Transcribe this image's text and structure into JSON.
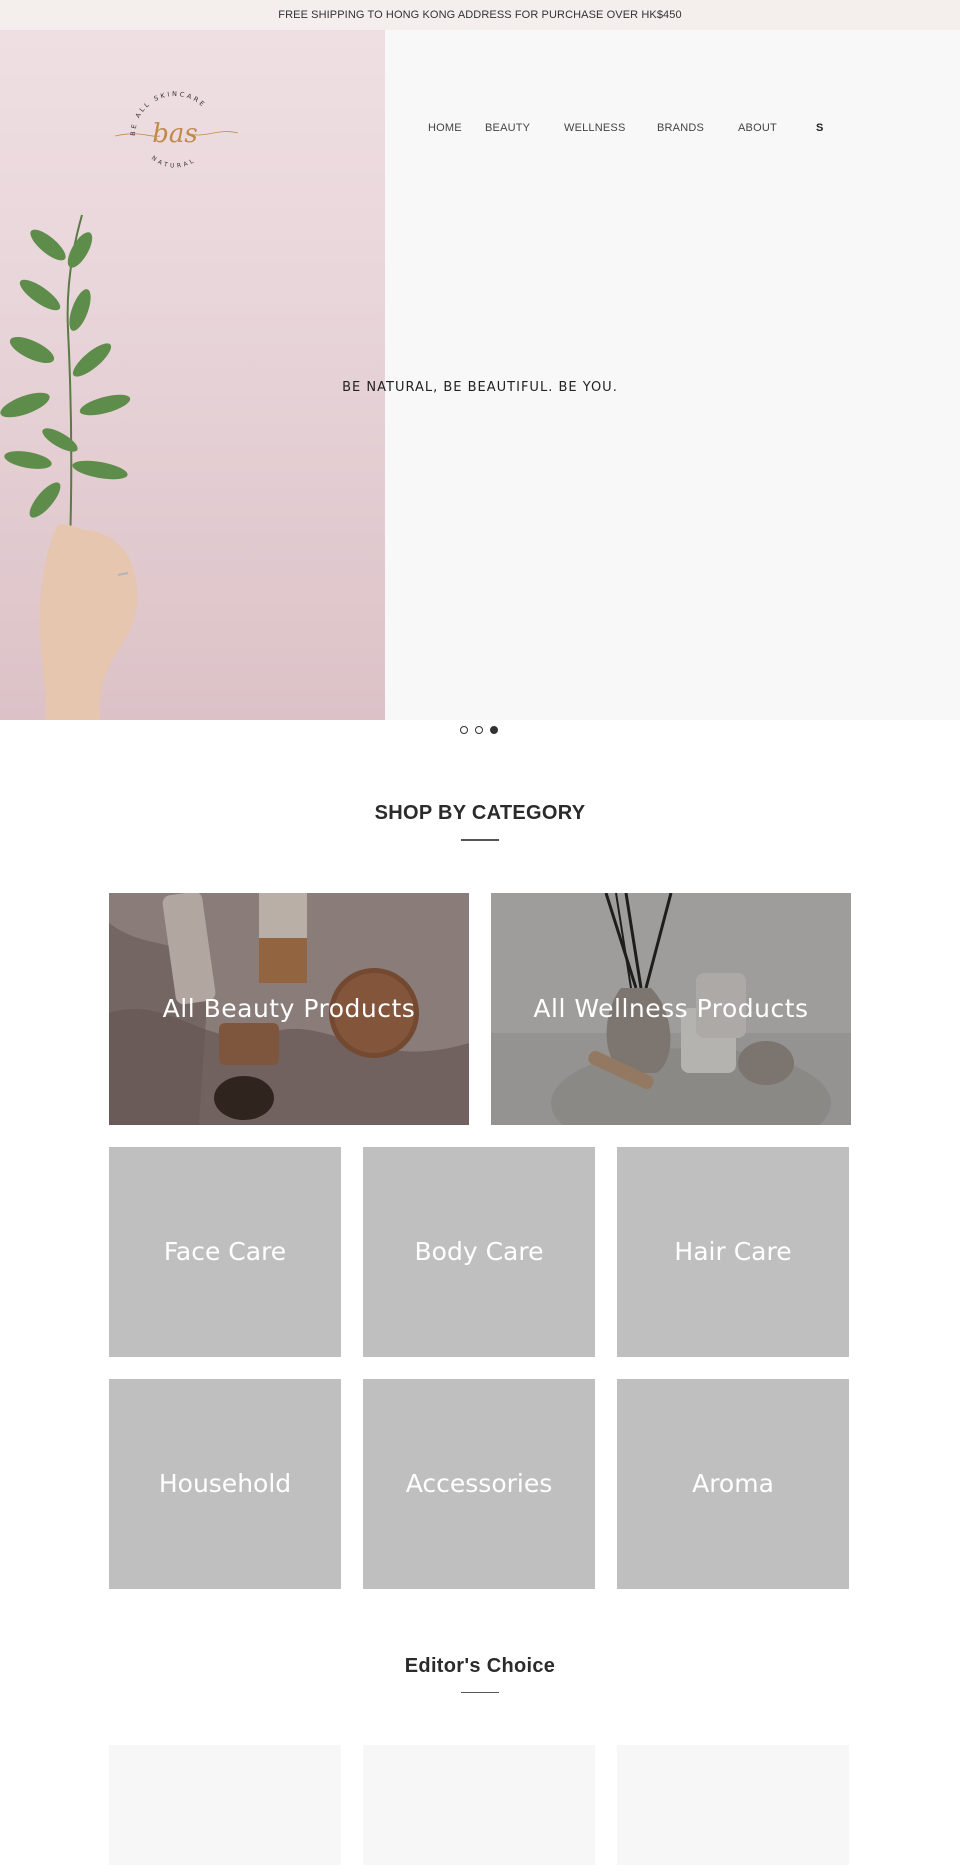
{
  "announcement": "FREE SHIPPING TO HONG KONG ADDRESS FOR PURCHASE OVER HK$450",
  "logo": {
    "top_text": "BE ALL SKINCARE",
    "mark": "bas",
    "bottom_text": "NATURAL"
  },
  "nav": {
    "items": [
      {
        "label": "HOME"
      },
      {
        "label": "BEAUTY"
      },
      {
        "label": "WELLNESS"
      },
      {
        "label": "BRANDS"
      },
      {
        "label": "ABOUT"
      }
    ],
    "cart_label": "S"
  },
  "hero": {
    "tagline": "BE NATURAL, BE BEAUTIFUL. BE YOU.",
    "slides": 3,
    "active_slide": 3
  },
  "shop_by_category": {
    "title": "SHOP BY CATEGORY",
    "featured": [
      {
        "label": "All Beauty Products"
      },
      {
        "label": "All Wellness Products"
      }
    ],
    "categories": [
      {
        "label": "Face Care"
      },
      {
        "label": "Body Care"
      },
      {
        "label": "Hair Care"
      },
      {
        "label": "Household"
      },
      {
        "label": "Accessories"
      },
      {
        "label": "Aroma"
      }
    ]
  },
  "editors_choice": {
    "title": "Editor's Choice",
    "cards": 3
  },
  "colors": {
    "announcement_bg": "#f4efed",
    "hero_bg": "#f8f8f8",
    "hero_pink": "#e8d5d9",
    "tile_gray": "#bfbfbf",
    "logo_gold": "#c08a4a"
  }
}
